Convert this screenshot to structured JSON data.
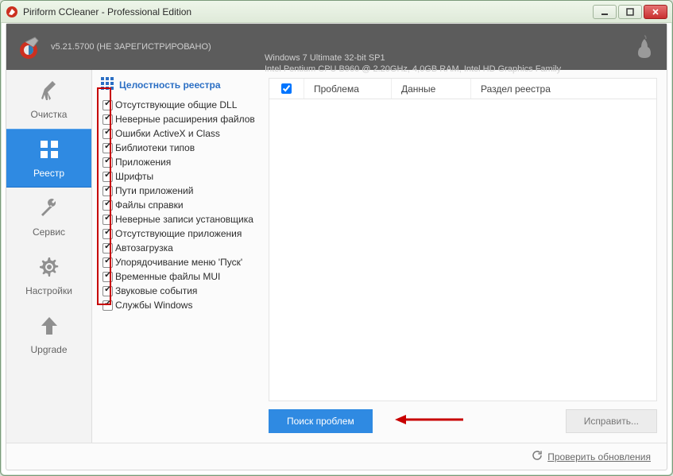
{
  "window": {
    "title": "Piriform CCleaner - Professional Edition"
  },
  "header": {
    "version": "v5.21.5700 (НЕ ЗАРЕГИСТРИРОВАНО)",
    "os_line": "Windows 7 Ultimate 32-bit SP1",
    "hw_line": "Intel Pentium CPU B960 @ 2.20GHz, 4,0GB RAM, Intel HD Graphics Family"
  },
  "sidebar": {
    "items": [
      {
        "label": "Очистка",
        "icon": "broom-icon"
      },
      {
        "label": "Реестр",
        "icon": "grid-icon",
        "active": true
      },
      {
        "label": "Сервис",
        "icon": "wrench-icon"
      },
      {
        "label": "Настройки",
        "icon": "gear-icon"
      },
      {
        "label": "Upgrade",
        "icon": "arrow-up-icon"
      }
    ]
  },
  "registry": {
    "section_title": "Целостность реестра",
    "items": [
      "Отсутствующие общие DLL",
      "Неверные расширения файлов",
      "Ошибки ActiveX и Class",
      "Библиотеки типов",
      "Приложения",
      "Шрифты",
      "Пути приложений",
      "Файлы справки",
      "Неверные записи установщика",
      "Отсутствующие приложения",
      "Автозагрузка",
      "Упорядочивание меню 'Пуск'",
      "Временные файлы MUI",
      "Звуковые события",
      "Службы Windows"
    ]
  },
  "table": {
    "columns": [
      "Проблема",
      "Данные",
      "Раздел реестра"
    ]
  },
  "buttons": {
    "scan": "Поиск проблем",
    "fix": "Исправить..."
  },
  "footer": {
    "check_updates": "Проверить обновления"
  }
}
